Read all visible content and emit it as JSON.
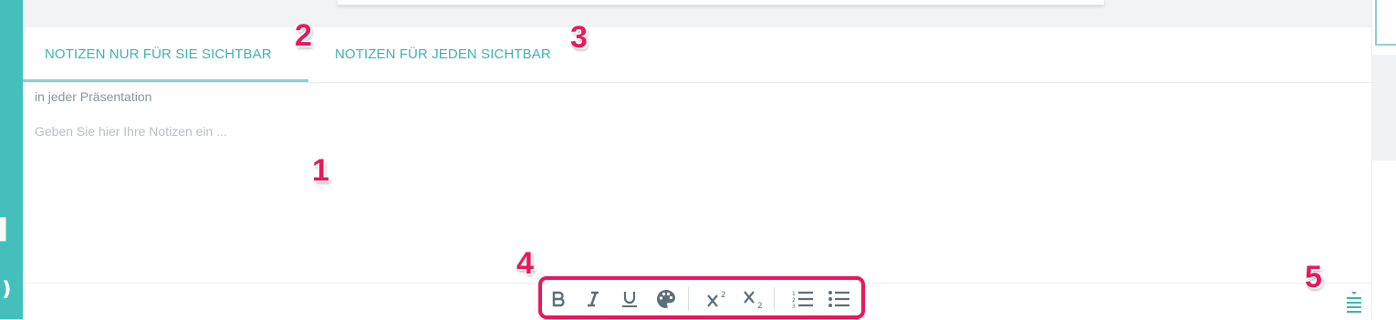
{
  "tabs": [
    {
      "label": "NOTIZEN NUR FÜR SIE SICHTBAR",
      "active": true
    },
    {
      "label": "NOTIZEN FÜR JEDEN SICHTBAR",
      "active": false
    }
  ],
  "notes": {
    "scope_label": "in jeder Präsentation",
    "placeholder": "Geben Sie hier Ihre Notizen ein ..."
  },
  "toolbar": {
    "buttons": [
      {
        "name": "bold",
        "icon": "bold-icon",
        "glyph": "B"
      },
      {
        "name": "italic",
        "icon": "italic-icon",
        "glyph": "I"
      },
      {
        "name": "underline",
        "icon": "underline-icon",
        "glyph": "U"
      },
      {
        "name": "text-color",
        "icon": "palette-icon"
      },
      {
        "name": "superscript",
        "icon": "superscript-icon"
      },
      {
        "name": "subscript",
        "icon": "subscript-icon"
      },
      {
        "name": "ordered-list",
        "icon": "ordered-list-icon"
      },
      {
        "name": "unordered-list",
        "icon": "unordered-list-icon"
      }
    ]
  },
  "markers": [
    "1",
    "2",
    "3",
    "4",
    "5"
  ],
  "colors": {
    "accent": "#44bfbb",
    "tab_text": "#3cb3af",
    "highlight": "#e8185e",
    "icon": "#5d6f77"
  }
}
